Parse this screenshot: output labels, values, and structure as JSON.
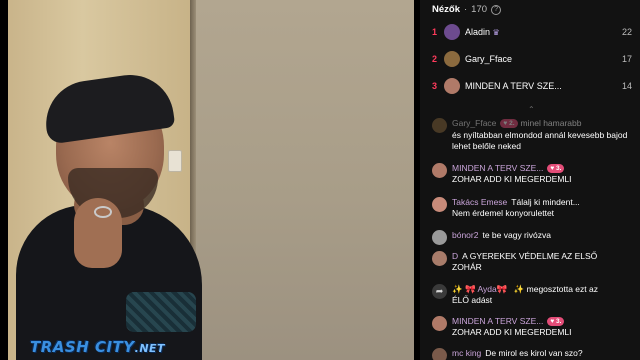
{
  "stream": {
    "watermark_main": "TRASH CITY",
    "watermark_suffix": ".NET"
  },
  "viewers": {
    "title": "Nézők",
    "separator": "·",
    "count": "170",
    "info_icon": "question-circle-icon",
    "top": [
      {
        "rank": "1",
        "name": "Aladin",
        "badge_icon": "crown-icon",
        "score": "22",
        "avatar_color": "#6d4b8f"
      },
      {
        "rank": "2",
        "name": "Gary_Fface",
        "score": "17",
        "avatar_color": "#8b6a3e"
      },
      {
        "rank": "3",
        "name": "MINDEN A TERV SZE...",
        "score": "14",
        "avatar_color": "#b07a68"
      }
    ],
    "collapse_glyph": "⌃"
  },
  "chat": {
    "messages": [
      {
        "user": "Gary_Fface",
        "badge": "2",
        "text_inline": "minel hamarabb",
        "text": "és nyíltabban elmondod annál kevesebb bajod lehet belőle neked",
        "avatar_color": "#8b6a3e"
      },
      {
        "user": "MINDEN A TERV SZE...",
        "badge": "3",
        "text": "ZOHAR ADD KI MEGERDEMLI",
        "avatar_color": "#b07a68"
      },
      {
        "user": "Takács Emese",
        "text_inline": "Tálalj ki mindent...",
        "text": "Nem érdemel konyorulettet",
        "avatar_color": "#c88b7a"
      },
      {
        "user": "bónor2",
        "text_inline": "te be vagy rivózva",
        "avatar_color": "#9a9a9a"
      },
      {
        "user": "D",
        "text_inline": "A GYEREKEK VÉDELME AZ ELSŐ",
        "text": "ZOHÁR",
        "avatar_color": "#a87c6a"
      },
      {
        "user": "Ayda",
        "decor_left": "✨",
        "decor_mid": "🎀",
        "decor_right": "✨",
        "text_inline": "megosztotta ezt az",
        "text": "ÉLŐ adást",
        "icon": "share-icon"
      },
      {
        "user": "MINDEN A TERV SZE...",
        "badge": "3",
        "text": "ZOHAR ADD KI MEGERDEMLI",
        "avatar_color": "#b07a68"
      },
      {
        "user": "mc king",
        "text_inline": "De mirol es kirol van szo?",
        "avatar_color": "#7a5a4a"
      }
    ]
  }
}
